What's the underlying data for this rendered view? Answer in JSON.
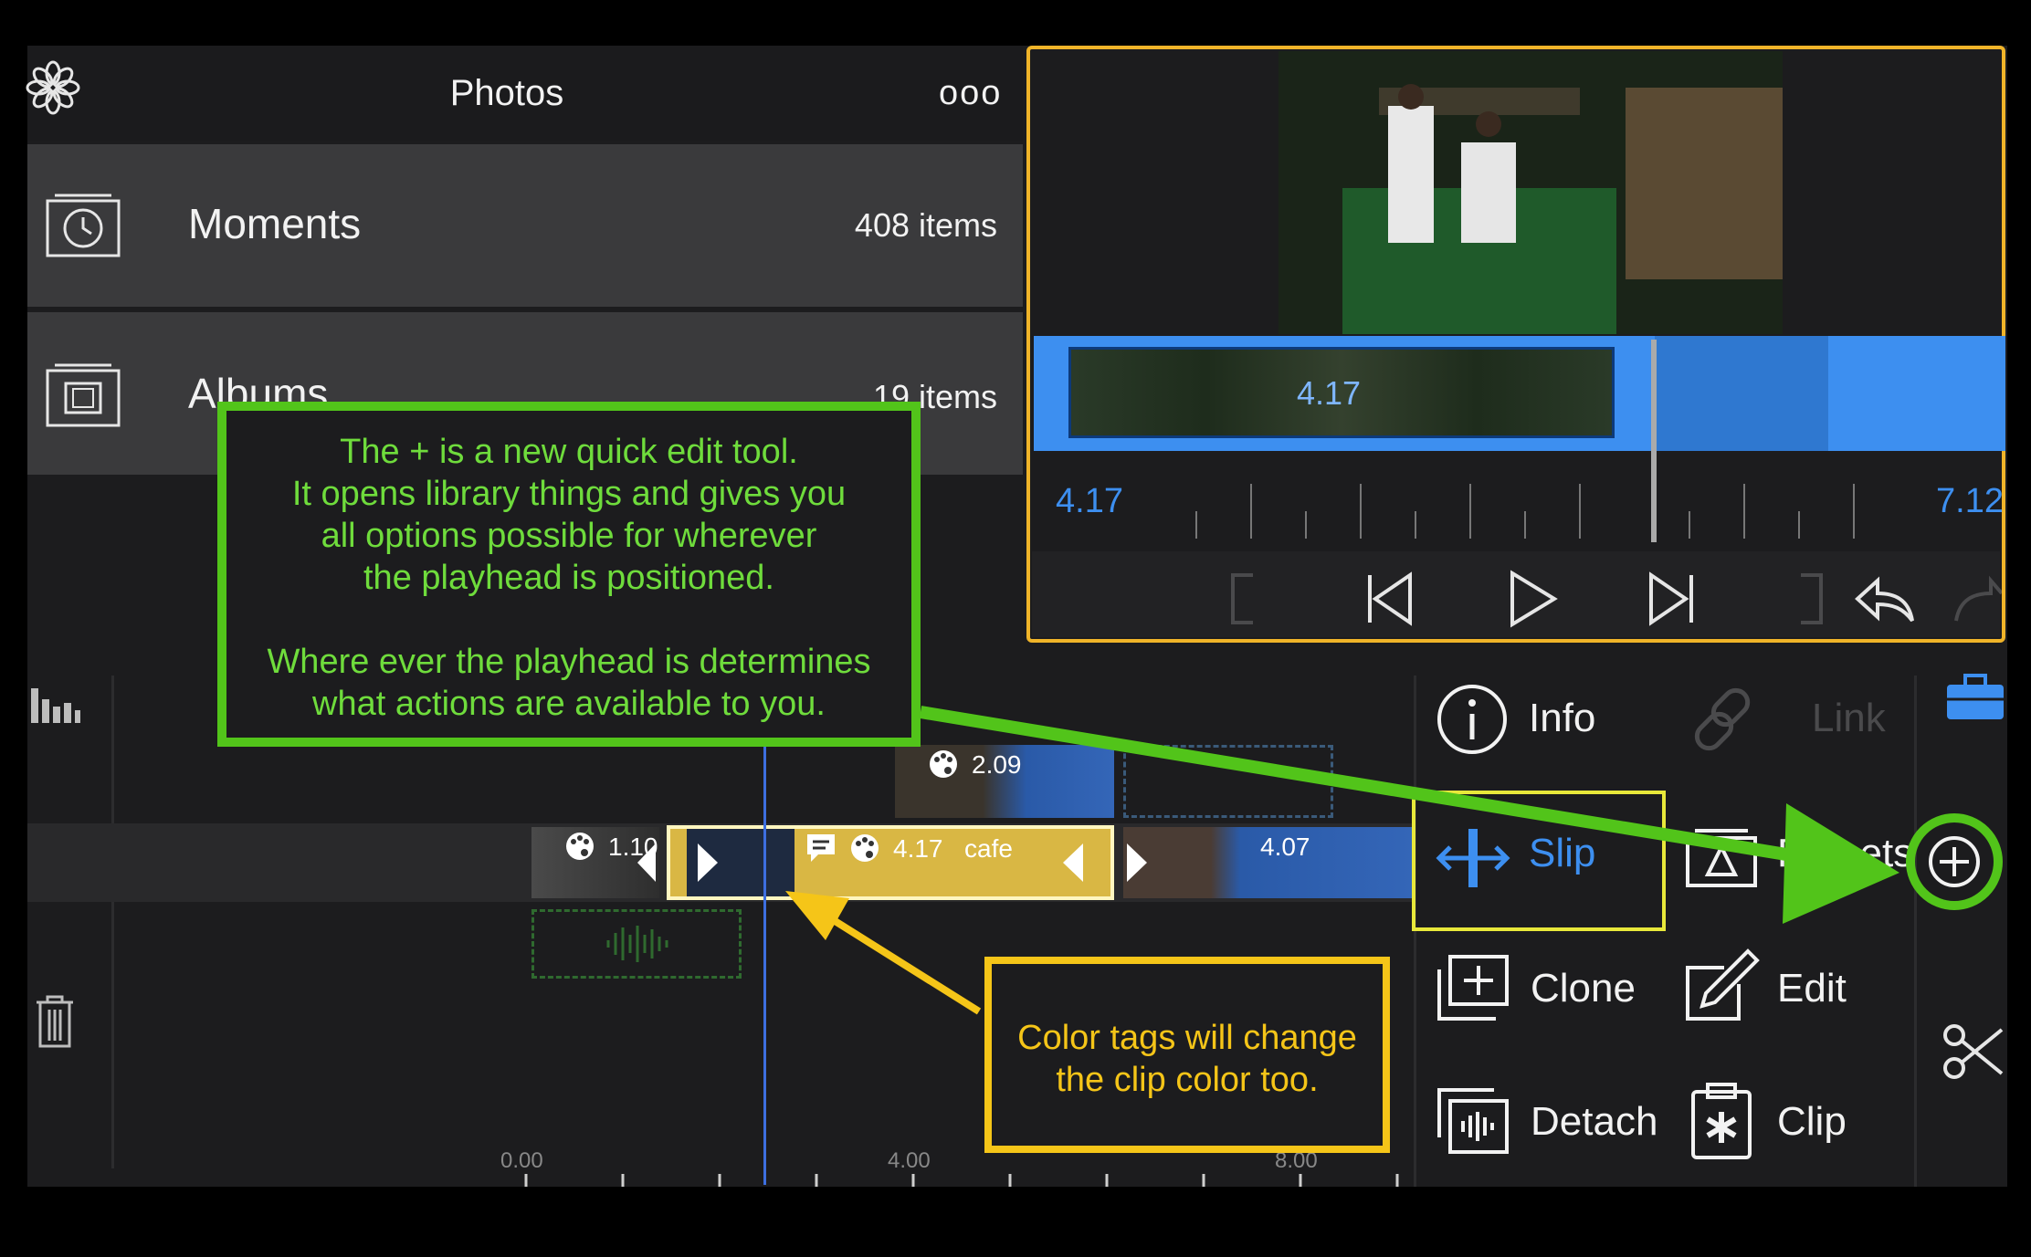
{
  "photos": {
    "title": "Photos",
    "more": "ooo",
    "rows": [
      {
        "label": "Moments",
        "count": "408 items"
      },
      {
        "label": "Albums",
        "count": "19 items"
      }
    ]
  },
  "preview": {
    "strip_time": "4.17",
    "ruler_start": "4.17",
    "ruler_end": "7.12"
  },
  "timeline": {
    "clips": [
      {
        "label": "1.10"
      },
      {
        "label": "4.17",
        "name": "cafe"
      },
      {
        "label": "4.07"
      },
      {
        "label": "2.09"
      }
    ],
    "ticks": [
      "0.00",
      "4.00",
      "8.00"
    ]
  },
  "actions": {
    "info": "Info",
    "link": "Link",
    "slip": "Slip",
    "presets": "Presets",
    "clone": "Clone",
    "edit": "Edit",
    "detach": "Detach",
    "clip": "Clip"
  },
  "annotations": {
    "green": [
      "The + is a new quick edit tool.",
      "It opens library things and gives you",
      "all options possible for wherever",
      "the playhead is positioned.",
      "",
      "Where ever the playhead is determines",
      "what actions are available to you."
    ],
    "yellow": [
      "Color tags will change",
      "the clip color too."
    ]
  },
  "colors": {
    "accent_blue": "#3d8ff0",
    "preview_border": "#f0b429",
    "annotation_green": "#52c41a",
    "annotation_yellow": "#f5c518"
  }
}
